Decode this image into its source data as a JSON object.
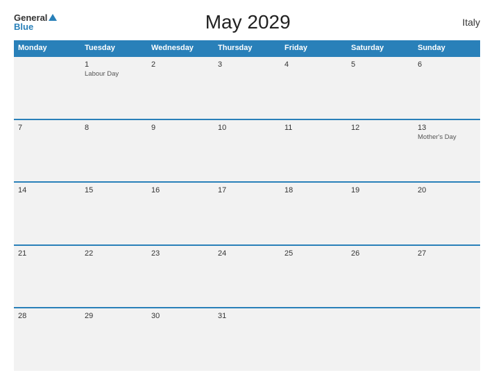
{
  "header": {
    "logo_general": "General",
    "logo_blue": "Blue",
    "title": "May 2029",
    "country": "Italy"
  },
  "calendar": {
    "headers": [
      "Monday",
      "Tuesday",
      "Wednesday",
      "Thursday",
      "Friday",
      "Saturday",
      "Sunday"
    ],
    "weeks": [
      [
        {
          "day": "",
          "event": ""
        },
        {
          "day": "1",
          "event": "Labour Day"
        },
        {
          "day": "2",
          "event": ""
        },
        {
          "day": "3",
          "event": ""
        },
        {
          "day": "4",
          "event": ""
        },
        {
          "day": "5",
          "event": ""
        },
        {
          "day": "6",
          "event": ""
        }
      ],
      [
        {
          "day": "7",
          "event": ""
        },
        {
          "day": "8",
          "event": ""
        },
        {
          "day": "9",
          "event": ""
        },
        {
          "day": "10",
          "event": ""
        },
        {
          "day": "11",
          "event": ""
        },
        {
          "day": "12",
          "event": ""
        },
        {
          "day": "13",
          "event": "Mother's Day"
        }
      ],
      [
        {
          "day": "14",
          "event": ""
        },
        {
          "day": "15",
          "event": ""
        },
        {
          "day": "16",
          "event": ""
        },
        {
          "day": "17",
          "event": ""
        },
        {
          "day": "18",
          "event": ""
        },
        {
          "day": "19",
          "event": ""
        },
        {
          "day": "20",
          "event": ""
        }
      ],
      [
        {
          "day": "21",
          "event": ""
        },
        {
          "day": "22",
          "event": ""
        },
        {
          "day": "23",
          "event": ""
        },
        {
          "day": "24",
          "event": ""
        },
        {
          "day": "25",
          "event": ""
        },
        {
          "day": "26",
          "event": ""
        },
        {
          "day": "27",
          "event": ""
        }
      ],
      [
        {
          "day": "28",
          "event": ""
        },
        {
          "day": "29",
          "event": ""
        },
        {
          "day": "30",
          "event": ""
        },
        {
          "day": "31",
          "event": ""
        },
        {
          "day": "",
          "event": ""
        },
        {
          "day": "",
          "event": ""
        },
        {
          "day": "",
          "event": ""
        }
      ]
    ]
  }
}
